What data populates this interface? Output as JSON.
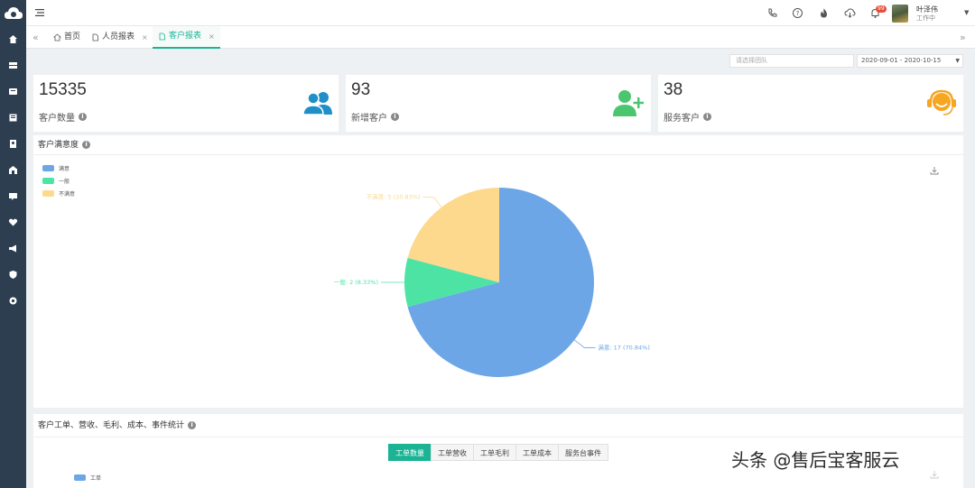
{
  "topbar": {
    "user_name": "叶泽伟",
    "user_status": "工作中",
    "notification_count": "99"
  },
  "tabs": [
    {
      "label": "首页"
    },
    {
      "label": "人员报表"
    },
    {
      "label": "客户报表"
    }
  ],
  "filters": {
    "team_placeholder": "请选择团队",
    "date_range": "2020-09-01 - 2020-10-15"
  },
  "stats": [
    {
      "value": "15335",
      "label": "客户数量"
    },
    {
      "value": "93",
      "label": "新增客户"
    },
    {
      "value": "38",
      "label": "服务客户"
    }
  ],
  "satisfaction_panel": {
    "title": "客户满意度"
  },
  "chart_data": {
    "type": "pie",
    "legend": [
      "满意",
      "一般",
      "不满意"
    ],
    "slices": [
      {
        "name": "满意",
        "value": 17,
        "label": "满意: 17 (70.84%)",
        "color": "#6ca6e6"
      },
      {
        "name": "一般",
        "value": 2,
        "label": "一般: 2 (8.33%)",
        "color": "#4de3a4"
      },
      {
        "name": "不满意",
        "value": 5,
        "label": "不满意: 5 (20.83%)",
        "color": "#fcd98d"
      }
    ]
  },
  "stats_panel": {
    "title": "客户工单、营收、毛利、成本、事件统计",
    "tabs": [
      "工单数量",
      "工单营收",
      "工单毛利",
      "工单成本",
      "服务台事件"
    ],
    "legend": "工单"
  },
  "watermark": "头条 @售后宝客服云",
  "colors": {
    "accent": "#1ab394",
    "sidebar": "#2c3e50",
    "stat_icon_blue": "#1f8fc8",
    "stat_icon_green": "#4cc56f",
    "stat_icon_orange": "#f5a623"
  }
}
